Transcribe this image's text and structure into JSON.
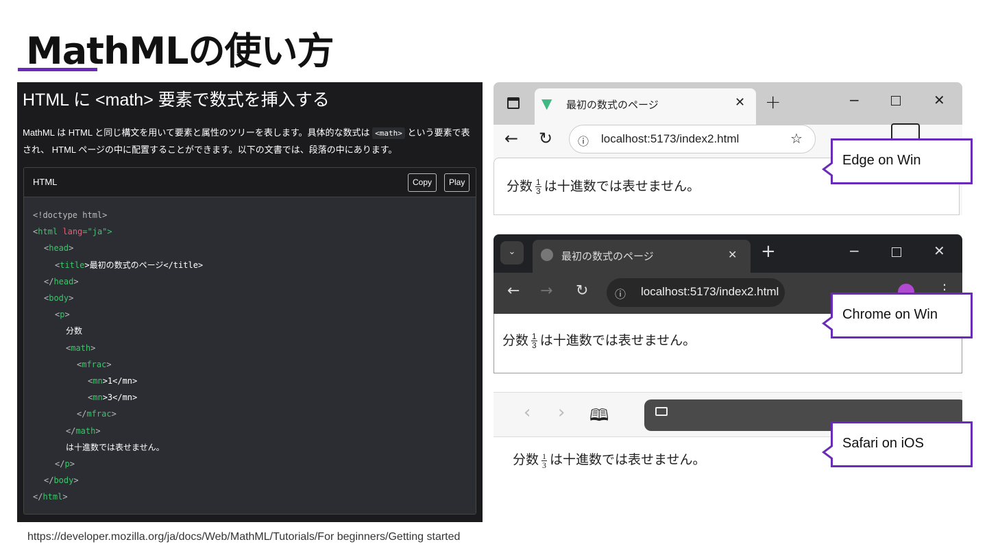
{
  "slide": {
    "title": "MathMLの使い方",
    "source": "https://developer.mozilla.org/ja/docs/Web/MathML/Tutorials/For beginners/Getting started",
    "accent": "#6a2cb8"
  },
  "mdn": {
    "heading": "HTML に <math> 要素で数式を挿入する",
    "para_a": "MathML は HTML と同じ構文を用いて要素と属性のツリーを表します。具体的な数式は ",
    "para_code": "<math>",
    "para_b": " という要素で表され、 HTML ページの中に配置することができます。以下の文書では、段落の中にあります。",
    "code_lang": "HTML",
    "copy": "Copy",
    "play": "Play",
    "code": [
      [
        "0",
        "<!doctype html>",
        "",
        "",
        ""
      ],
      [
        "0",
        "<",
        "html",
        " lang",
        "=\"ja\">"
      ],
      [
        "1",
        "<",
        "head",
        ">",
        ""
      ],
      [
        "2",
        "<",
        "title",
        ">最初の数式のページ</title>",
        ""
      ],
      [
        "1",
        "</",
        "head",
        ">",
        ""
      ],
      [
        "1",
        "<",
        "body",
        ">",
        ""
      ],
      [
        "2",
        "<",
        "p",
        ">",
        ""
      ],
      [
        "3",
        "",
        "",
        "分数",
        ""
      ],
      [
        "3",
        "<",
        "math",
        ">",
        ""
      ],
      [
        "4",
        "<",
        "mfrac",
        ">",
        ""
      ],
      [
        "5",
        "<",
        "mn",
        ">1</mn>",
        ""
      ],
      [
        "5",
        "<",
        "mn",
        ">3</mn>",
        ""
      ],
      [
        "4",
        "</",
        "mfrac",
        ">",
        ""
      ],
      [
        "3",
        "</",
        "math",
        ">",
        ""
      ],
      [
        "3",
        "",
        "",
        "は十進数では表せません。",
        ""
      ],
      [
        "2",
        "</",
        "p",
        ">",
        ""
      ],
      [
        "1",
        "</",
        "body",
        ">",
        ""
      ],
      [
        "0",
        "</",
        "html",
        ">",
        ""
      ]
    ]
  },
  "page": {
    "before": "分数",
    "num": "1",
    "den": "3",
    "after": "は十進数では表せません。"
  },
  "edge": {
    "tab_title": "最初の数式のページ",
    "url": "localhost:5173/index2.html",
    "label": "Edge on Win"
  },
  "chrome": {
    "tab_title": "最初の数式のページ",
    "url": "localhost:5173/index2.html",
    "label": "Chrome on Win"
  },
  "safari": {
    "label": "Safari on iOS"
  }
}
